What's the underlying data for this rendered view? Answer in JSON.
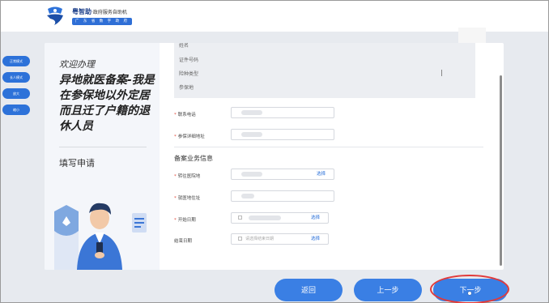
{
  "header": {
    "app_name": "粤智助",
    "app_subtitle": "·政府服务自助机",
    "tagline": "广 东 省 数 字 政 府"
  },
  "side_nav": [
    "正常模式",
    "长人模式",
    "放大",
    "缩小"
  ],
  "left_panel": {
    "welcome": "欢迎办理",
    "service_title": "异地就医备案-我是在参保地以外定居而且迁了户籍的退休人员",
    "step": "填写申请"
  },
  "readonly_info": [
    "姓名",
    "证件号码",
    "险种类型",
    "参保地"
  ],
  "contact_fields": [
    {
      "label": "联系电话",
      "required": true,
      "value": ""
    },
    {
      "label": "参保详细地址",
      "required": true,
      "value": ""
    }
  ],
  "section_title": "备案业务信息",
  "business_fields": [
    {
      "label": "转往医院地",
      "required": true,
      "value": "",
      "action": "选择",
      "date": false
    },
    {
      "label": "就医地住址",
      "required": true,
      "value": "",
      "action": "",
      "date": false
    },
    {
      "label": "开始日期",
      "required": true,
      "value": "",
      "action": "选择",
      "date": true
    },
    {
      "label": "结束日期",
      "required": false,
      "value": "",
      "placeholder": "请选择结束日期",
      "action": "选择",
      "date": true
    }
  ],
  "buttons": {
    "back": "返回",
    "prev": "上一步",
    "next": "下一步"
  },
  "colors": {
    "accent": "#3a7fe4",
    "highlight": "#e23a3a",
    "required": "#e24b3b"
  }
}
